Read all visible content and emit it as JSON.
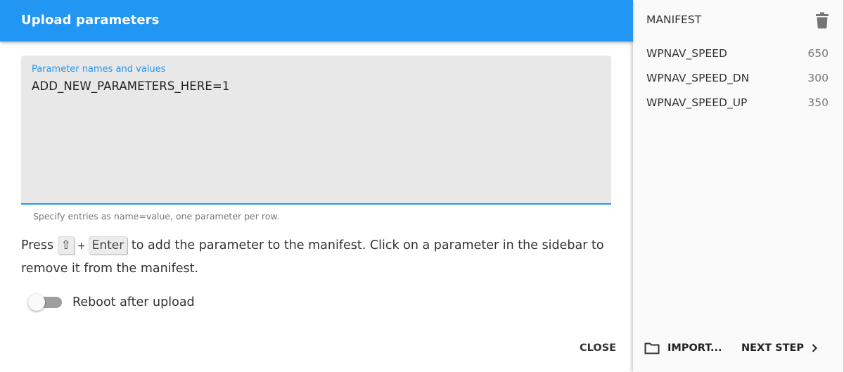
{
  "dialog": {
    "title": "Upload parameters",
    "colors": {
      "accent": "#2196f3",
      "field_bg": "#e8e8e8",
      "sidebar_bg": "#fafafa"
    }
  },
  "editor": {
    "label": "Parameter names and values",
    "value": "ADD_NEW_PARAMETERS_HERE=1",
    "helper_text": "Specify entries as name=value, one parameter per row."
  },
  "instructions": {
    "press": "Press",
    "key_shift": "⇧",
    "plus": "+",
    "key_enter": "Enter",
    "rest": "to add the parameter to the manifest. Click on a parameter in the sidebar to remove it from the manifest."
  },
  "reboot_toggle": {
    "label": "Reboot after upload",
    "checked": false
  },
  "actions": {
    "close_label": "CLOSE",
    "import_label": "IMPORT...",
    "next_label": "NEXT STEP"
  },
  "manifest": {
    "title": "MANIFEST",
    "clear_icon": "trash-icon",
    "items": [
      {
        "name": "WPNAV_SPEED",
        "value": "650"
      },
      {
        "name": "WPNAV_SPEED_DN",
        "value": "300"
      },
      {
        "name": "WPNAV_SPEED_UP",
        "value": "350"
      }
    ]
  }
}
